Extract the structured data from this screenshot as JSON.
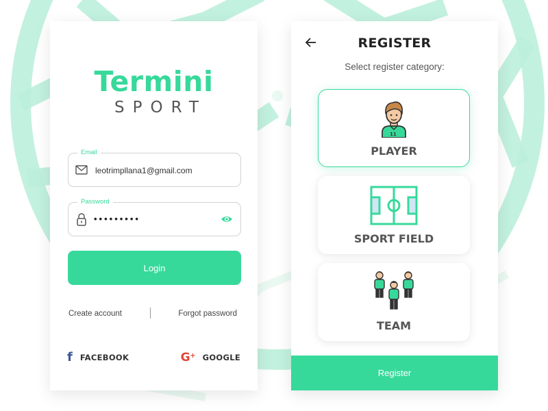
{
  "login": {
    "brand": {
      "title": "Termini",
      "subtitle": "SPORT"
    },
    "email": {
      "label": "Email",
      "value": "leotrimpllana1@gmail.com"
    },
    "password": {
      "label": "Password",
      "masked_value": "•••••••••"
    },
    "login_label": "Login",
    "create_account_label": "Create account",
    "forgot_password_label": "Forgot password",
    "social": {
      "facebook": {
        "label": "FACEBOOK",
        "icon": "facebook-icon"
      },
      "google": {
        "label": "GOOGLE",
        "icon": "google-plus-icon"
      }
    }
  },
  "register": {
    "title": "REGISTER",
    "subtitle": "Select register category:",
    "categories": [
      {
        "label": "PLAYER",
        "icon": "player-icon",
        "selected": true
      },
      {
        "label": "SPORT FIELD",
        "icon": "sport-field-icon",
        "selected": false
      },
      {
        "label": "TEAM",
        "icon": "team-icon",
        "selected": false
      }
    ],
    "register_label": "Register"
  },
  "colors": {
    "accent": "#37d99b",
    "background_pattern": "#a8ecd3",
    "facebook": "#3b5998",
    "google": "#e0483a"
  }
}
